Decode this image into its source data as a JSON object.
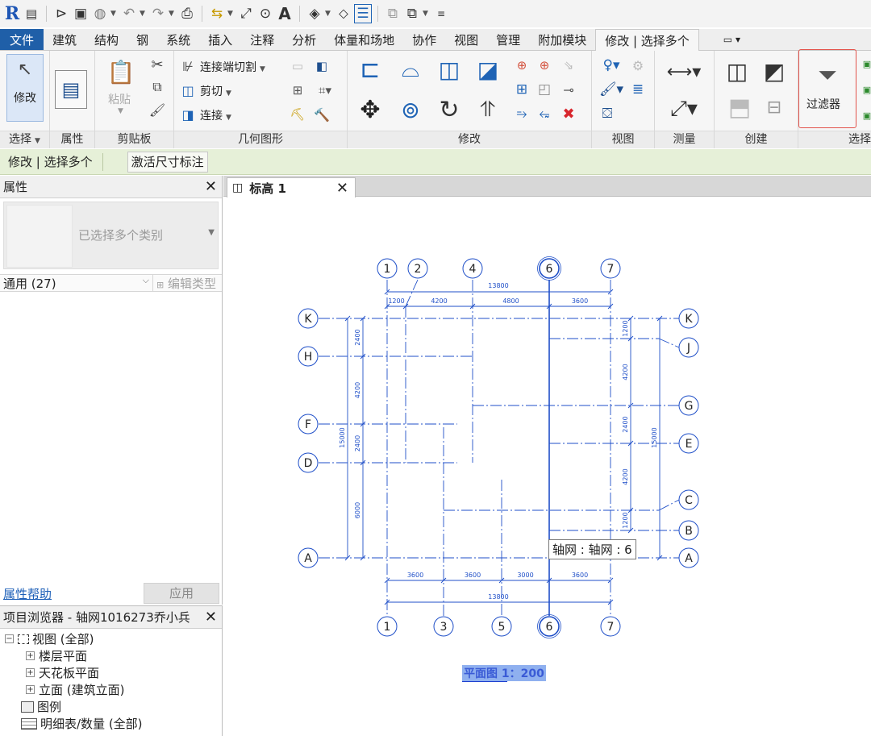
{
  "ribbon": {
    "tabs": [
      "文件",
      "建筑",
      "结构",
      "钢",
      "系统",
      "插入",
      "注释",
      "分析",
      "体量和场地",
      "协作",
      "视图",
      "管理",
      "附加模块",
      "修改 | 选择多个"
    ],
    "panels": {
      "select": {
        "title": "选择",
        "modify_label": "修改"
      },
      "properties": {
        "title": "属性"
      },
      "clipboard": {
        "title": "剪贴板",
        "paste_label": "粘贴"
      },
      "geometry": {
        "title": "几何图形",
        "cut_end_label": "连接端切割",
        "cut_label": "剪切",
        "join_label": "连接"
      },
      "modify": {
        "title": "修改"
      },
      "view": {
        "title": "视图"
      },
      "measure": {
        "title": "测量"
      },
      "create": {
        "title": "创建"
      },
      "selection": {
        "title": "选择",
        "filter_label": "过滤器"
      }
    }
  },
  "context_bar": {
    "mode_label": "修改 | 选择多个",
    "button_label": "激活尺寸标注"
  },
  "properties": {
    "title": "属性",
    "type_selector_text": "已选择多个类别",
    "filter_value": "通用 (27)",
    "edit_type_label": "编辑类型",
    "help_link": "属性帮助",
    "apply_label": "应用"
  },
  "project_browser": {
    "title": "项目浏览器 - 轴网1016273乔小兵",
    "items": [
      {
        "label": "视图 (全部)",
        "toggle": "−"
      },
      {
        "label": "楼层平面",
        "toggle": "+"
      },
      {
        "label": "天花板平面",
        "toggle": "+"
      },
      {
        "label": "立面 (建筑立面)",
        "toggle": "+"
      },
      {
        "label": "图例",
        "toggle": ""
      },
      {
        "label": "明细表/数量 (全部)",
        "toggle": ""
      }
    ]
  },
  "view_tab": {
    "label": "标高 1"
  },
  "drawing": {
    "top_grid_labels": [
      "1",
      "2",
      "4",
      "6",
      "7"
    ],
    "bottom_grid_labels": [
      "1",
      "3",
      "5",
      "6",
      "7"
    ],
    "left_grid_labels": [
      "K",
      "H",
      "F",
      "D",
      "A"
    ],
    "right_grid_labels": [
      "K",
      "J",
      "G",
      "E",
      "C",
      "B",
      "A"
    ],
    "top_total_dim": "13800",
    "top_dims": [
      "1200",
      "4200",
      "4800",
      "3600"
    ],
    "bottom_dims": [
      "3600",
      "3600",
      "3000",
      "3600"
    ],
    "bottom_total_dim": "13800",
    "left_dims": [
      "2400",
      "4200",
      "2400",
      "6000"
    ],
    "left_total_dim": "15000",
    "right_dims": [
      "1200",
      "4200",
      "2400",
      "4200",
      "1200"
    ],
    "right_total_dim": "15000",
    "tooltip": "轴网 : 轴网 : 6",
    "plan_title": "平面图 1：200"
  },
  "colors": {
    "grid_blue": "#1f4fc8",
    "file_tab": "#1f5fa8",
    "context_bar": "#e6f0d8",
    "highlight": "#e2534b"
  }
}
